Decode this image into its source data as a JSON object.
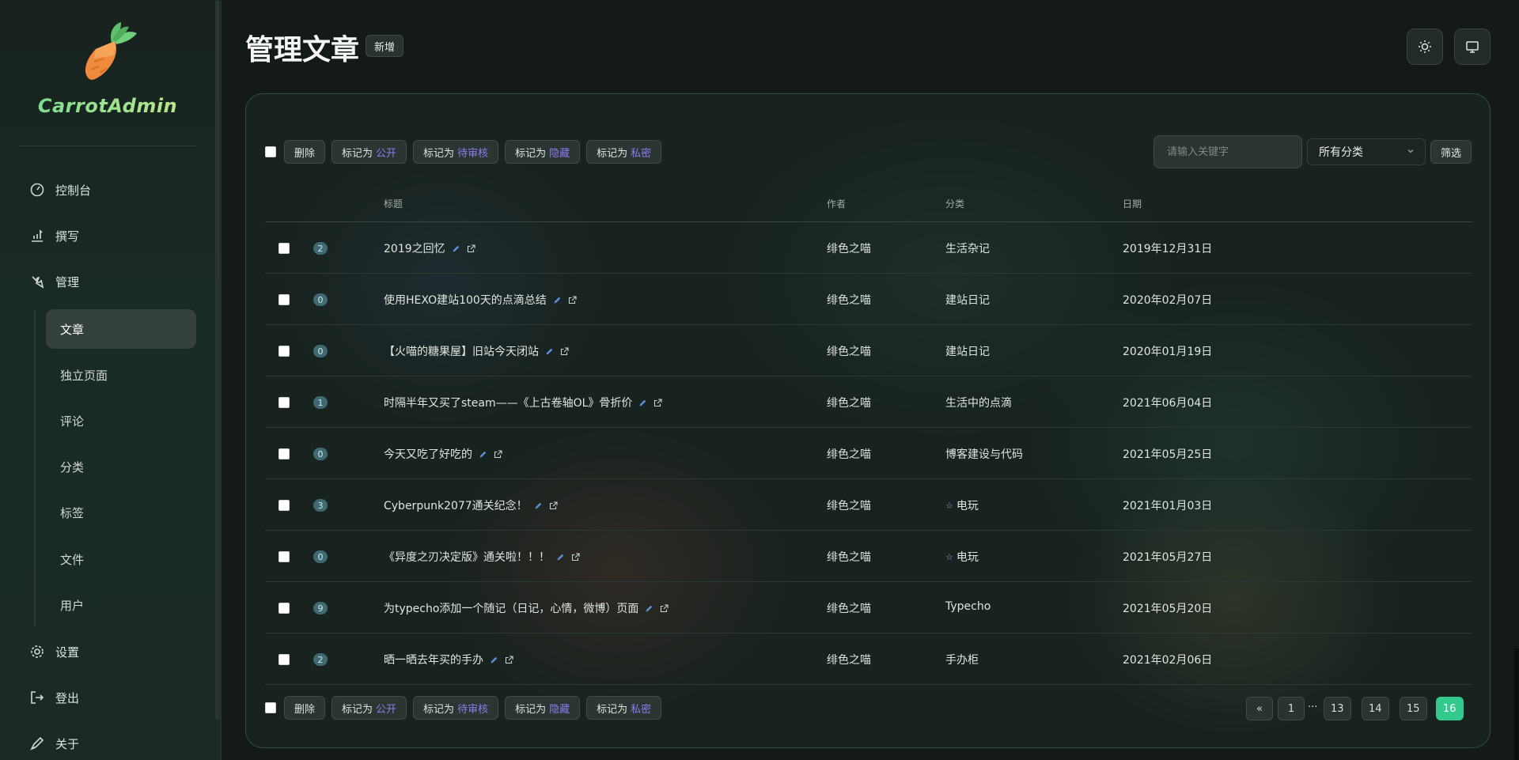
{
  "app": {
    "name": "CarrotAdmin"
  },
  "sidebar": {
    "items": [
      {
        "label": "控制台",
        "icon": "dashboard-icon"
      },
      {
        "label": "撰写",
        "icon": "write-icon"
      },
      {
        "label": "管理",
        "icon": "wrench-icon"
      },
      {
        "label": "设置",
        "icon": "gear-icon"
      },
      {
        "label": "登出",
        "icon": "logout-icon"
      },
      {
        "label": "关于",
        "icon": "pen-icon"
      }
    ],
    "manage_sub": [
      {
        "label": "文章",
        "active": true
      },
      {
        "label": "独立页面"
      },
      {
        "label": "评论"
      },
      {
        "label": "分类"
      },
      {
        "label": "标签"
      },
      {
        "label": "文件"
      },
      {
        "label": "用户"
      }
    ]
  },
  "header": {
    "title": "管理文章",
    "add_label": "新增"
  },
  "toolbar": {
    "delete": "删除",
    "mark_prefix": "标记为",
    "public": "公开",
    "pending": "待审核",
    "hidden": "隐藏",
    "private": "私密",
    "search_placeholder": "请输入关键字",
    "category_selected": "所有分类",
    "filter": "筛选"
  },
  "table": {
    "columns": [
      "标题",
      "作者",
      "分类",
      "日期"
    ],
    "rows": [
      {
        "count": "2",
        "title": "2019之回忆",
        "author": "绯色之喵",
        "category": "生活杂记",
        "date": "2019年12月31日"
      },
      {
        "count": "0",
        "title": "使用HEXO建站100天的点滴总结",
        "author": "绯色之喵",
        "category": "建站日记",
        "date": "2020年02月07日"
      },
      {
        "count": "0",
        "title": "【火喵的糖果屋】旧站今天闭站",
        "author": "绯色之喵",
        "category": "建站日记",
        "date": "2020年01月19日"
      },
      {
        "count": "1",
        "title": "时隔半年又买了steam——《上古卷轴OL》骨折价",
        "author": "绯色之喵",
        "category": "生活中的点滴",
        "date": "2021年06月04日"
      },
      {
        "count": "0",
        "title": "今天又吃了好吃的",
        "author": "绯色之喵",
        "category": "博客建设与代码",
        "date": "2021年05月25日"
      },
      {
        "count": "3",
        "title": "Cyberpunk2077通关纪念！",
        "author": "绯色之喵",
        "category": "电玩",
        "category_icon": "☆",
        "date": "2021年01月03日"
      },
      {
        "count": "0",
        "title": "《异度之刃决定版》通关啦！！！",
        "author": "绯色之喵",
        "category": "电玩",
        "category_icon": "☆",
        "date": "2021年05月27日"
      },
      {
        "count": "9",
        "title": "为typecho添加一个随记（日记，心情，微博）页面",
        "author": "绯色之喵",
        "category": "Typecho",
        "date": "2021年05月20日"
      },
      {
        "count": "2",
        "title": "晒一晒去年买的手办",
        "author": "绯色之喵",
        "category": "手办柜",
        "date": "2021年02月06日"
      }
    ]
  },
  "pagination": {
    "prev": "«",
    "pages": [
      "1",
      "13",
      "14",
      "15",
      "16"
    ],
    "dots": "···",
    "current": "16"
  },
  "colors": {
    "accent": "#34c98f",
    "mark_text": "#8c7cf0",
    "logo": "#7fdc9c"
  }
}
